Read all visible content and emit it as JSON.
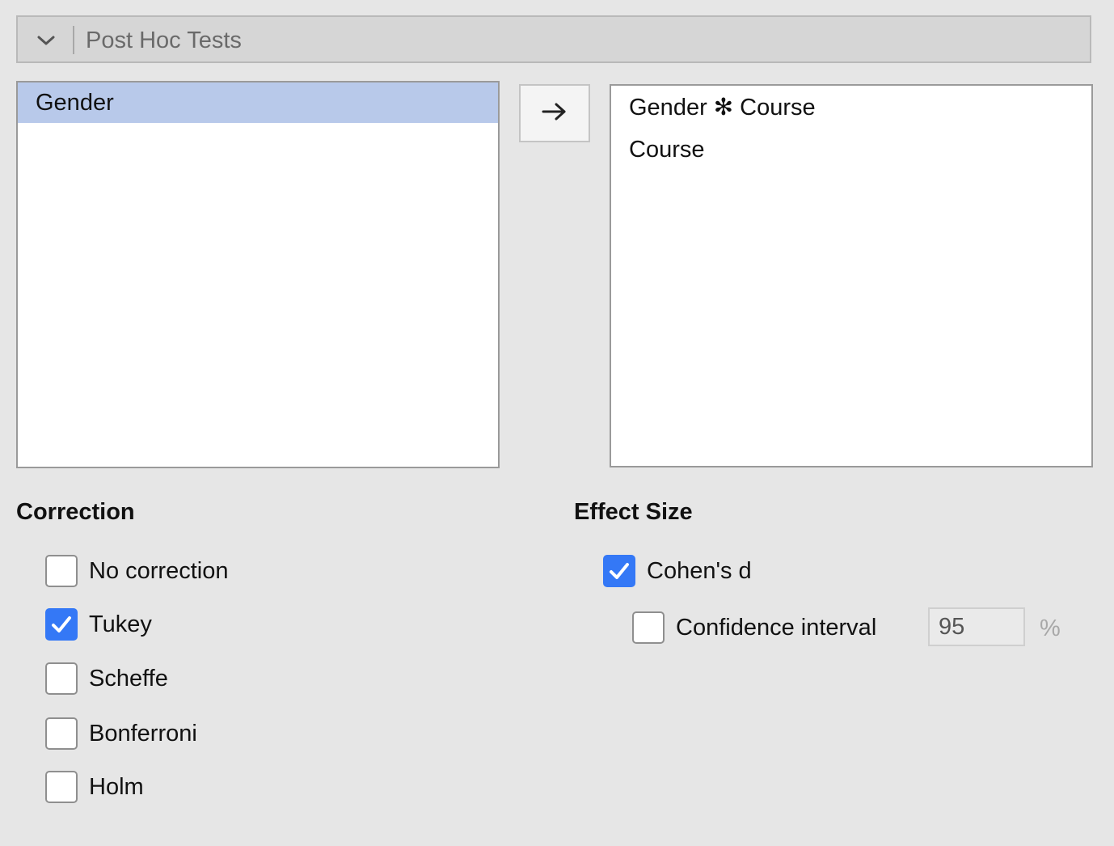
{
  "header": {
    "title": "Post Hoc Tests",
    "collapse_icon": "chevron-down-icon"
  },
  "source_list": {
    "items": [
      {
        "label": "Gender",
        "selected": true
      }
    ]
  },
  "move_button": {
    "icon": "arrow-right-icon"
  },
  "target_list": {
    "items": [
      {
        "label": "Gender ✻ Course"
      },
      {
        "label": "Course"
      }
    ]
  },
  "correction": {
    "title": "Correction",
    "options": [
      {
        "label": "No correction",
        "checked": false
      },
      {
        "label": "Tukey",
        "checked": true
      },
      {
        "label": "Scheffe",
        "checked": false
      },
      {
        "label": "Bonferroni",
        "checked": false
      },
      {
        "label": "Holm",
        "checked": false
      }
    ]
  },
  "effect_size": {
    "title": "Effect Size",
    "cohens_d": {
      "label": "Cohen's d",
      "checked": true
    },
    "confidence_interval": {
      "label": "Confidence interval",
      "checked": false,
      "value": "95",
      "unit": "%"
    }
  },
  "colors": {
    "checkbox_checked": "#3478f6",
    "selection": "#b8c9ea"
  }
}
